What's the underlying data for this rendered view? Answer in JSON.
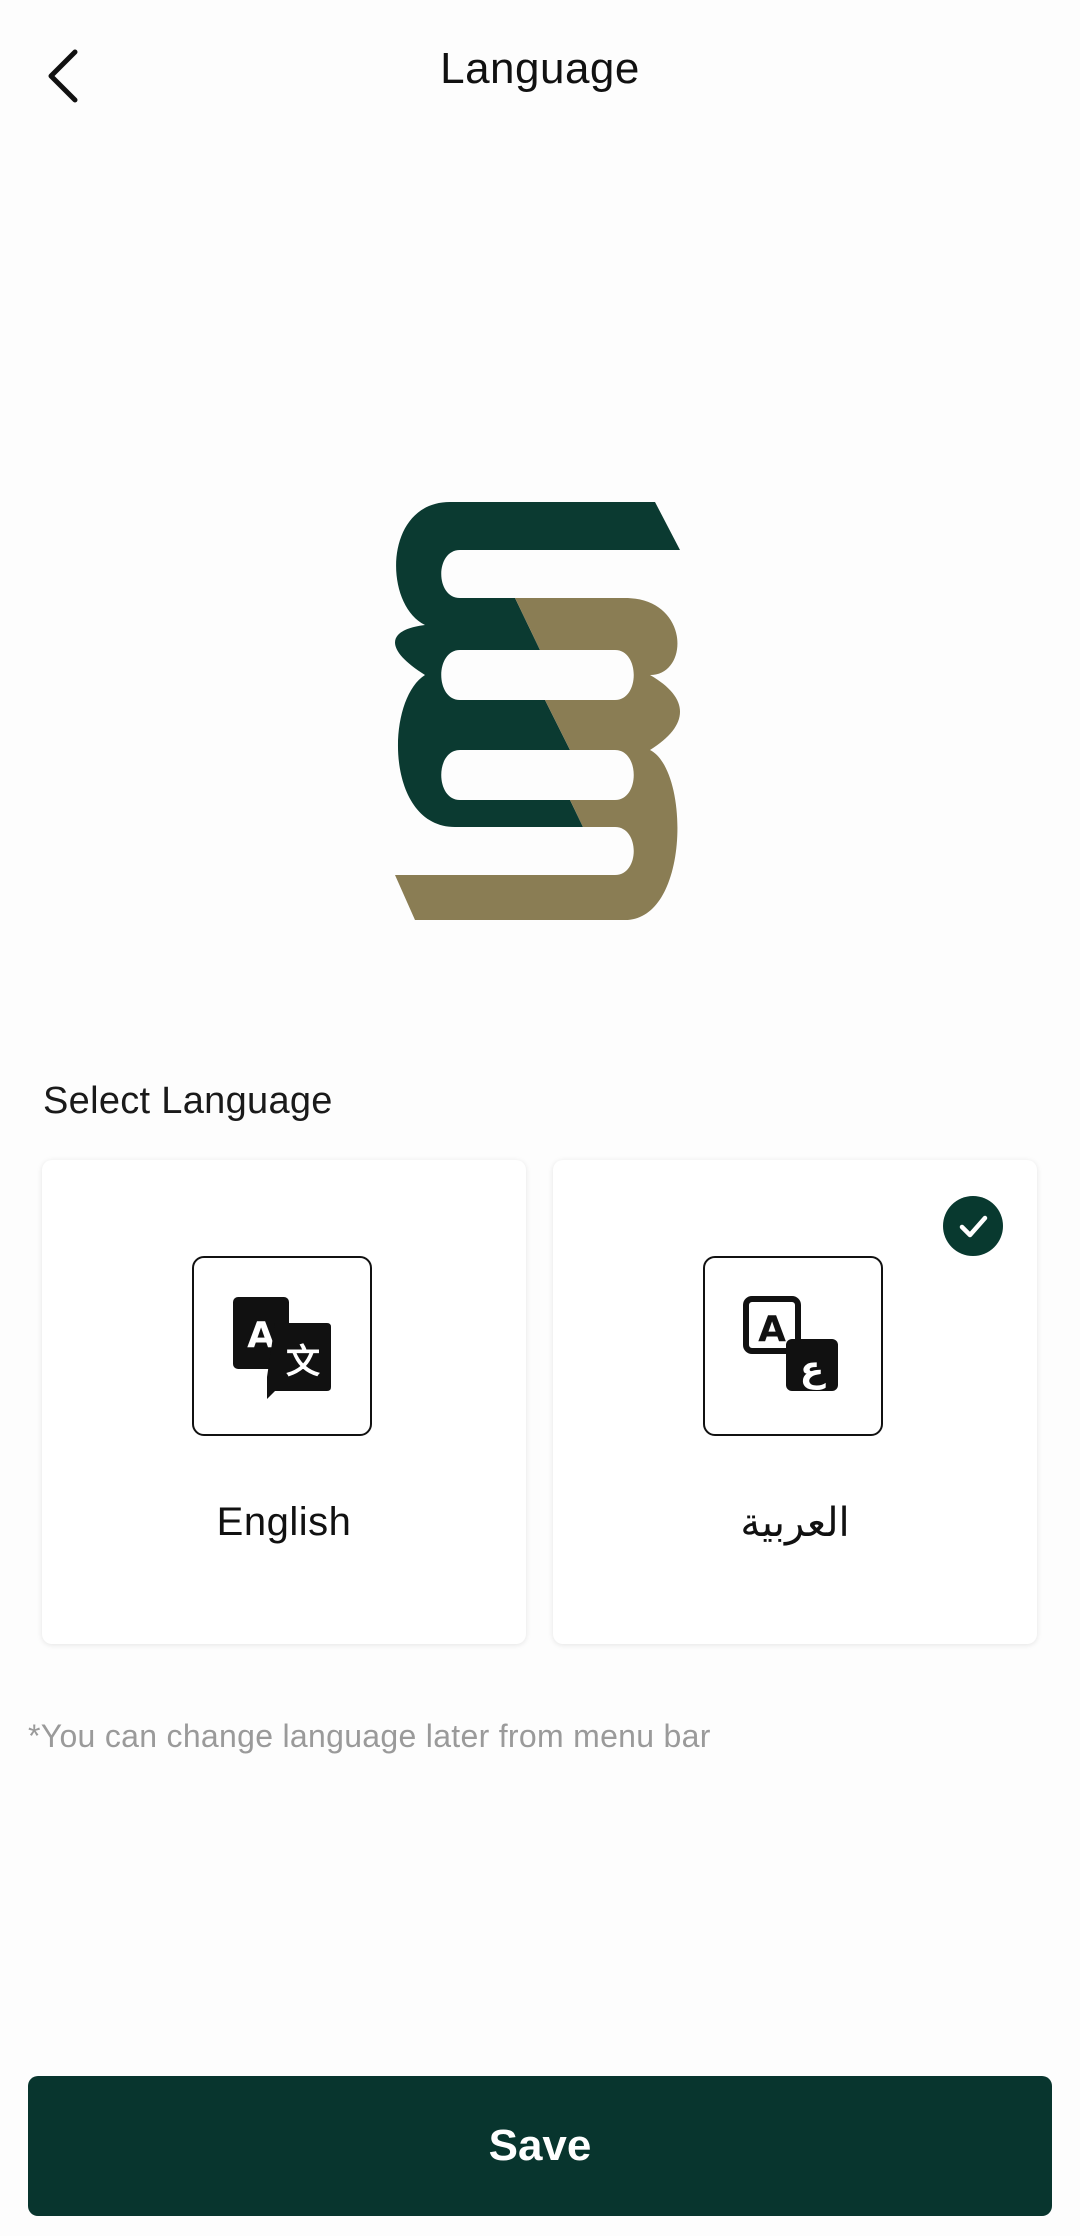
{
  "header": {
    "title": "Language",
    "back_icon": "chevron-left-icon"
  },
  "logo": {
    "name": "brand-logo",
    "colors": {
      "dark": "#0b3a31",
      "gold": "#8a7d54"
    }
  },
  "section": {
    "label": "Select Language"
  },
  "languages": [
    {
      "label": "English",
      "icon": "translate-icon",
      "selected": false
    },
    {
      "label": "العربية",
      "icon": "translate-arabic-icon",
      "selected": true
    }
  ],
  "hint": "*You can change language later from menu bar",
  "save": {
    "label": "Save"
  },
  "colors": {
    "accent": "#08352e",
    "hint_text": "#9a9a9a",
    "background": "#fdfdfd"
  }
}
